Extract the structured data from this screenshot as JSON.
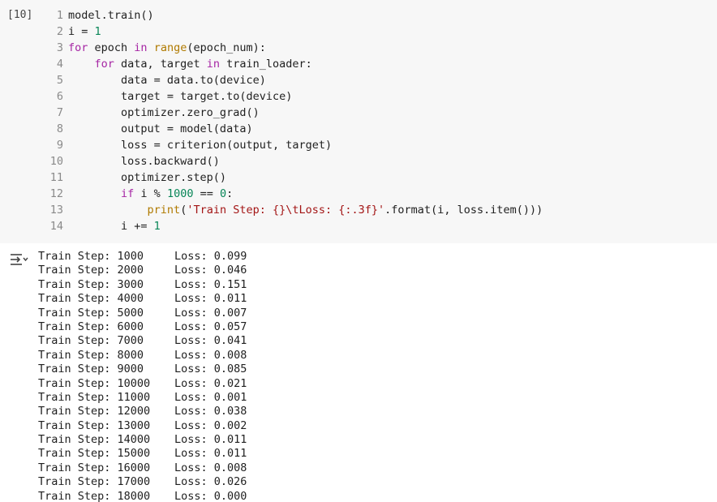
{
  "cell": {
    "execution_count": "[10]",
    "code_lines": [
      {
        "num": "1",
        "text": "model.train()"
      },
      {
        "num": "2",
        "text": "i = 1"
      },
      {
        "num": "3",
        "text": "for epoch in range(epoch_num):"
      },
      {
        "num": "4",
        "text": "    for data, target in train_loader:"
      },
      {
        "num": "5",
        "text": "        data = data.to(device)"
      },
      {
        "num": "6",
        "text": "        target = target.to(device)"
      },
      {
        "num": "7",
        "text": "        optimizer.zero_grad()"
      },
      {
        "num": "8",
        "text": "        output = model(data)"
      },
      {
        "num": "9",
        "text": "        loss = criterion(output, target)"
      },
      {
        "num": "10",
        "text": "        loss.backward()"
      },
      {
        "num": "11",
        "text": "        optimizer.step()"
      },
      {
        "num": "12",
        "text": "        if i % 1000 == 0:"
      },
      {
        "num": "13",
        "text": "            print('Train Step: {}\\tLoss: {:.3f}'.format(i, loss.item()))"
      },
      {
        "num": "14",
        "text": "        i += 1"
      }
    ]
  },
  "output": {
    "icon": "output-toggle-icon",
    "lines": [
      {
        "step": "Train Step: 1000",
        "loss": "Loss: 0.099"
      },
      {
        "step": "Train Step: 2000",
        "loss": "Loss: 0.046"
      },
      {
        "step": "Train Step: 3000",
        "loss": "Loss: 0.151"
      },
      {
        "step": "Train Step: 4000",
        "loss": "Loss: 0.011"
      },
      {
        "step": "Train Step: 5000",
        "loss": "Loss: 0.007"
      },
      {
        "step": "Train Step: 6000",
        "loss": "Loss: 0.057"
      },
      {
        "step": "Train Step: 7000",
        "loss": "Loss: 0.041"
      },
      {
        "step": "Train Step: 8000",
        "loss": "Loss: 0.008"
      },
      {
        "step": "Train Step: 9000",
        "loss": "Loss: 0.085"
      },
      {
        "step": "Train Step: 10000",
        "loss": "Loss: 0.021"
      },
      {
        "step": "Train Step: 11000",
        "loss": "Loss: 0.001"
      },
      {
        "step": "Train Step: 12000",
        "loss": "Loss: 0.038"
      },
      {
        "step": "Train Step: 13000",
        "loss": "Loss: 0.002"
      },
      {
        "step": "Train Step: 14000",
        "loss": "Loss: 0.011"
      },
      {
        "step": "Train Step: 15000",
        "loss": "Loss: 0.011"
      },
      {
        "step": "Train Step: 16000",
        "loss": "Loss: 0.008"
      },
      {
        "step": "Train Step: 17000",
        "loss": "Loss: 0.026"
      },
      {
        "step": "Train Step: 18000",
        "loss": "Loss: 0.000"
      }
    ]
  }
}
